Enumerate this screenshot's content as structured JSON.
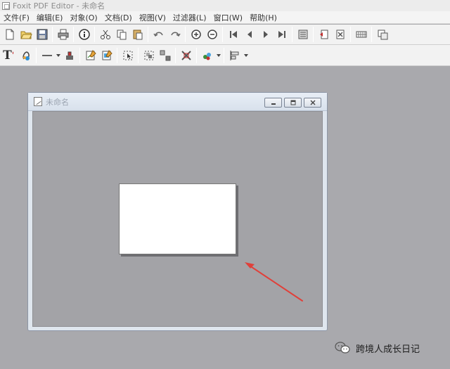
{
  "app": {
    "title": "Foxit PDF Editor - 未命名"
  },
  "menu": [
    "文件(F)",
    "编辑(E)",
    "对象(O)",
    "文档(D)",
    "视图(V)",
    "过滤器(L)",
    "窗口(W)",
    "帮助(H)"
  ],
  "toolbar1": [
    "new-document-icon",
    "open-folder-icon",
    "save-icon",
    "print-icon",
    "info-icon",
    "cut-icon",
    "copy-icon",
    "paste-icon",
    "undo-icon",
    "redo-icon",
    "zoom-in-icon",
    "zoom-out-icon",
    "first-page-icon",
    "previous-page-icon",
    "next-page-icon",
    "last-page-icon",
    "properties-icon",
    "insert-page-icon",
    "delete-page-icon",
    "grid-icon",
    "rotate-icon"
  ],
  "toolbar2": [
    "text-tool-icon",
    "color-picker-icon",
    "line-tool-icon",
    "stamp-icon",
    "edit-image-icon",
    "edit-object-icon",
    "select-object-icon",
    "group-icon",
    "ungroup-icon",
    "transform-icon",
    "layers-icon",
    "align-icon"
  ],
  "document": {
    "title": "未命名"
  },
  "watermark": {
    "text": "跨境人成长日记"
  },
  "colors": {
    "workspace": "#a9a9ad",
    "page": "#ffffff",
    "arrow": "#e0403a",
    "accent": "#c42f2f"
  }
}
